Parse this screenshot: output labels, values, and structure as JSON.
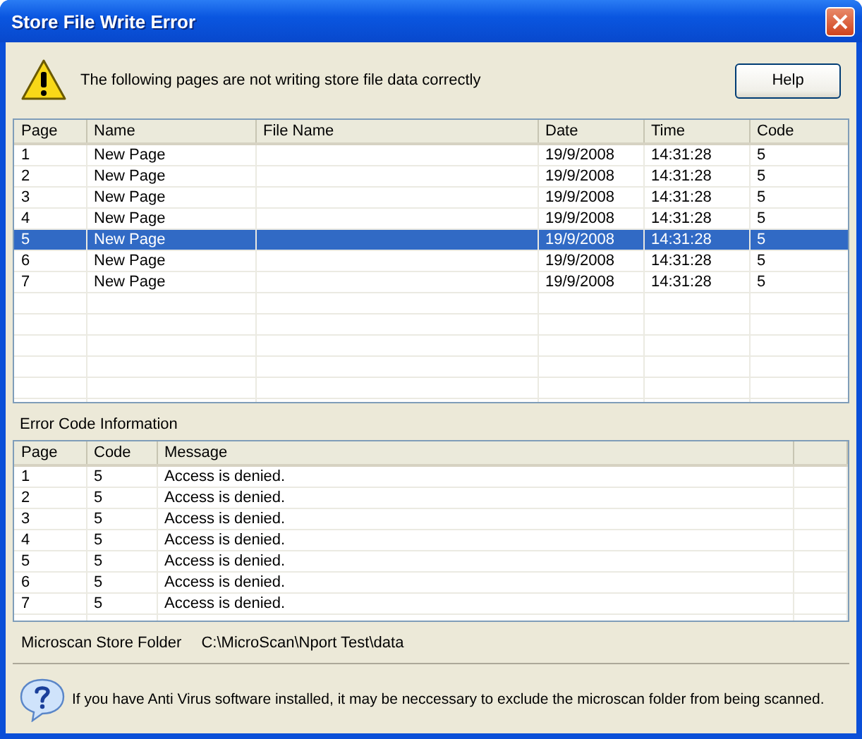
{
  "window": {
    "title": "Store File Write Error"
  },
  "message": "The following pages are not writing store file data correctly",
  "help_button": "Help",
  "pages_table": {
    "columns": [
      "Page",
      "Name",
      "File Name",
      "Date",
      "Time",
      "Code"
    ],
    "rows": [
      {
        "cells": [
          "1",
          "New Page",
          "",
          "19/9/2008",
          "14:31:28",
          "5"
        ],
        "selected": false
      },
      {
        "cells": [
          "2",
          "New Page",
          "",
          "19/9/2008",
          "14:31:28",
          "5"
        ],
        "selected": false
      },
      {
        "cells": [
          "3",
          "New Page",
          "",
          "19/9/2008",
          "14:31:28",
          "5"
        ],
        "selected": false
      },
      {
        "cells": [
          "4",
          "New Page",
          "",
          "19/9/2008",
          "14:31:28",
          "5"
        ],
        "selected": false
      },
      {
        "cells": [
          "5",
          "New Page",
          "",
          "19/9/2008",
          "14:31:28",
          "5"
        ],
        "selected": true
      },
      {
        "cells": [
          "6",
          "New Page",
          "",
          "19/9/2008",
          "14:31:28",
          "5"
        ],
        "selected": false
      },
      {
        "cells": [
          "7",
          "New Page",
          "",
          "19/9/2008",
          "14:31:28",
          "5"
        ],
        "selected": false
      }
    ]
  },
  "error_section_label": "Error Code Information",
  "errors_table": {
    "columns": [
      "Page",
      "Code",
      "Message"
    ],
    "rows": [
      [
        "1",
        "5",
        "Access is denied."
      ],
      [
        "2",
        "5",
        "Access is denied."
      ],
      [
        "3",
        "5",
        "Access is denied."
      ],
      [
        "4",
        "5",
        "Access is denied."
      ],
      [
        "5",
        "5",
        "Access is denied."
      ],
      [
        "6",
        "5",
        "Access is denied."
      ],
      [
        "7",
        "5",
        "Access is denied."
      ]
    ]
  },
  "store_folder": {
    "label": "Microscan Store Folder",
    "path": "C:\\MicroScan\\Nport Test\\data"
  },
  "info": "If you have Anti Virus software installed, it may be neccessary to exclude the microscan folder from being scanned."
}
